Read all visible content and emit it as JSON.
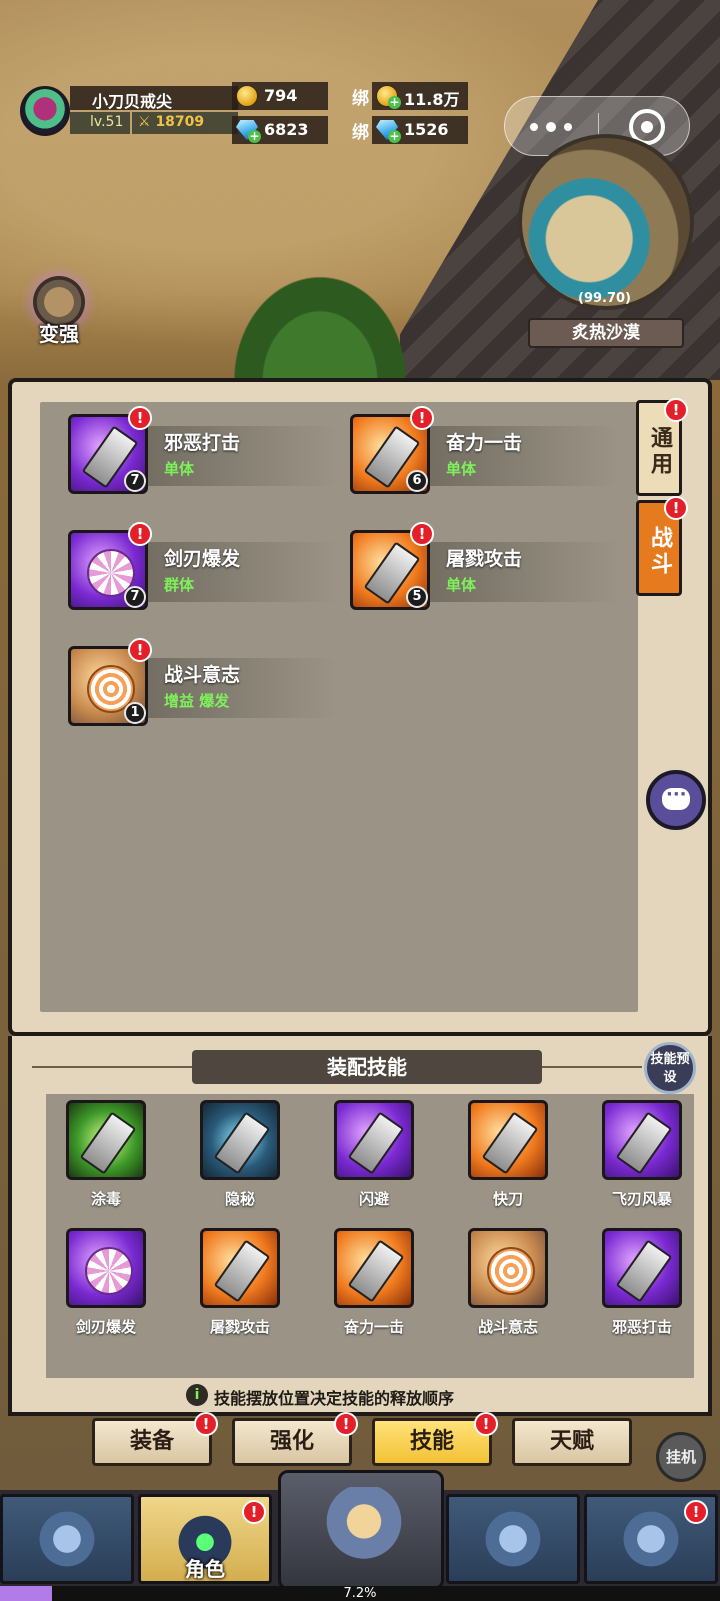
{
  "player": {
    "name": "小刀贝戒尖",
    "level": "lv.51",
    "power": "18709"
  },
  "resources": {
    "gold": "794",
    "bound_gold_label": "绑",
    "bound_gold": "11.8万",
    "gems": "6823",
    "bound_gems_label": "绑",
    "bound_gems": "1526"
  },
  "minimap": {
    "coords": "(99.70)",
    "zone": "炙热沙漠"
  },
  "strengthen_label": "变强",
  "skill_list": [
    {
      "name": "邪恶打击",
      "type": "单体",
      "level": "7",
      "icon": "sword-purple-icon"
    },
    {
      "name": "奋力一击",
      "type": "单体",
      "level": "6",
      "icon": "cleaver-orange-icon"
    },
    {
      "name": "剑刃爆发",
      "type": "群体",
      "level": "7",
      "icon": "swirl-purple-icon"
    },
    {
      "name": "屠戮攻击",
      "type": "单体",
      "level": "5",
      "icon": "dagger-orange-icon"
    },
    {
      "name": "战斗意志",
      "type": "增益 爆发",
      "level": "1",
      "icon": "spiral-tan-icon"
    }
  ],
  "side_tabs": {
    "general": "通用",
    "combat": "战斗"
  },
  "equip": {
    "title": "装配技能",
    "preset": "技能预设",
    "slots": [
      {
        "label": "涂毒",
        "icon": "poison-icon"
      },
      {
        "label": "隐秘",
        "icon": "hood-icon"
      },
      {
        "label": "闪避",
        "icon": "dodge-icon"
      },
      {
        "label": "快刀",
        "icon": "fast-blade-icon"
      },
      {
        "label": "飞刃风暴",
        "icon": "blade-storm-icon"
      },
      {
        "label": "剑刃爆发",
        "icon": "swirl-purple-icon"
      },
      {
        "label": "屠戮攻击",
        "icon": "dagger-orange-icon"
      },
      {
        "label": "奋力一击",
        "icon": "cleaver-orange-icon"
      },
      {
        "label": "战斗意志",
        "icon": "spiral-tan-icon"
      },
      {
        "label": "邪恶打击",
        "icon": "sword-purple-icon"
      }
    ],
    "hint": "技能摆放位置决定技能的释放顺序"
  },
  "sub_tabs": [
    "装备",
    "强化",
    "技能",
    "天赋"
  ],
  "autoplay": "挂机",
  "bottom_nav": {
    "role_label": "角色"
  },
  "exp": {
    "percent_text": "7.2%",
    "fraction": 0.072
  },
  "alert_mark": "!",
  "colors": {
    "accent": "#e57a1e",
    "type_green": "#7ef05a",
    "alert_red": "#e3202a"
  }
}
